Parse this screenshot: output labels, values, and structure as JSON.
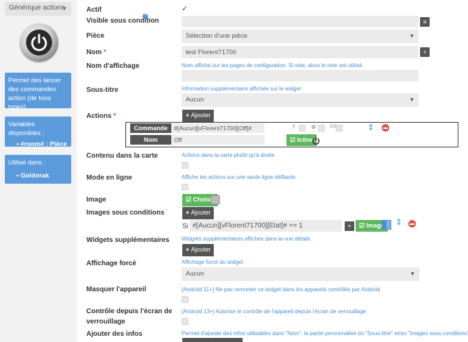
{
  "sidebar": {
    "type_select": "Générique actions",
    "description": "Permet des lancer des commandes action (de tous types)",
    "variables_title": "Variables disponibles :",
    "variables_item": "#room# : Pièce",
    "used_in_title": "Utilisé dans :",
    "used_in_item": "Goldorak"
  },
  "form": {
    "actif_label": "Actif",
    "actif_check": "✓",
    "visible_label": "Visible sous condition",
    "piece_label": "Pièce",
    "piece_value": "Sélection d'une pièce",
    "nom_label": "Nom",
    "nom_value": "test Florent71700",
    "affichage_label": "Nom d'affichage",
    "affichage_help": "Nom affiché sur les pages de configuration. Si vide, alors le nom est utilisé.",
    "soustitre_label": "Sous-titre",
    "soustitre_help": "Information supplémentaire affichée sur le widget",
    "soustitre_value": "Aucun",
    "actions_label": "Actions",
    "ajouter": "Ajouter",
    "commande_label": "Commande",
    "commande_value": "#[Aucun][vFlorent71700][Off]#",
    "nom_cmd_label": "Nom",
    "nom_cmd_value": "Off",
    "icone_btn": "Icône",
    "contenu_label": "Contenu dans la carte",
    "contenu_help": "Actions dans la carte plutôt qu'à droite",
    "mode_label": "Mode en ligne",
    "mode_help": "Affiche les actions sur une seule ligne défilante",
    "image_label": "Image",
    "choisir_btn": "Choisir",
    "images_cond_label": "Images sous conditions",
    "si_label": "Si",
    "condition_value": "#[Aucun][vFlorent71700][Etat]# == 1",
    "image_btn": "Image",
    "widgets_label": "Widgets supplémentaires",
    "widgets_help": "Widgets supplémentaires affichés dans la vue détails",
    "affichage_force_label": "Affichage forcé",
    "affichage_force_help": "Affichage forcé du widget",
    "affichage_force_value": "Aucun",
    "masquer_label": "Masquer l'appareil",
    "masquer_help": "[Android 11+] Ne pas remonter ce widget dans les appareils contrôlés par Android",
    "controle_label_1": "Contrôle depuis l'écran de",
    "controle_label_2": "verrouillage",
    "controle_help": "[Android 13+] Autorise le contrôle de l'appareil depuis l'écran de verrouillage",
    "ajouter_infos_label": "Ajouter des infos",
    "ajouter_infos_help": "Permet d'ajouter des infos utilisables dans \"Nom\", la partie personnalisé du \"Sous-titre\" et/ou \"Images sous conditions\"",
    "req_star": "*",
    "help_q": "?",
    "num_icon": "123"
  }
}
